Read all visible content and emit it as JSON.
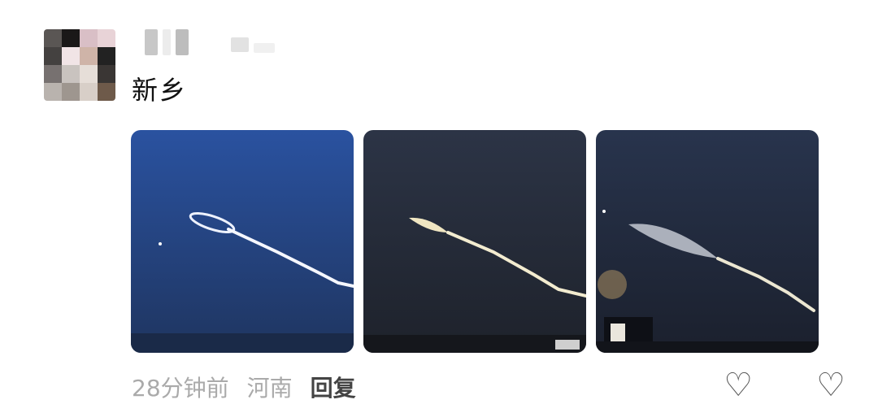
{
  "post": {
    "text": "新乡",
    "meta": {
      "time": "28分钟前",
      "location": "河南",
      "reply_label": "回复"
    },
    "photos": [
      {
        "name": "photo-1",
        "sky": "#2f4f8a",
        "sky_bottom": "#1d2f57"
      },
      {
        "name": "photo-2",
        "sky": "#2a3242",
        "sky_bottom": "#1f232c"
      },
      {
        "name": "photo-3",
        "sky": "#27324a",
        "sky_bottom": "#1c2231"
      }
    ]
  },
  "actions": {
    "like_icon": "heart-icon",
    "comment_icon": "heart-icon"
  },
  "colors": {
    "text": "#111111",
    "meta": "#aaaaaa",
    "trail": "#f3ecd0"
  }
}
